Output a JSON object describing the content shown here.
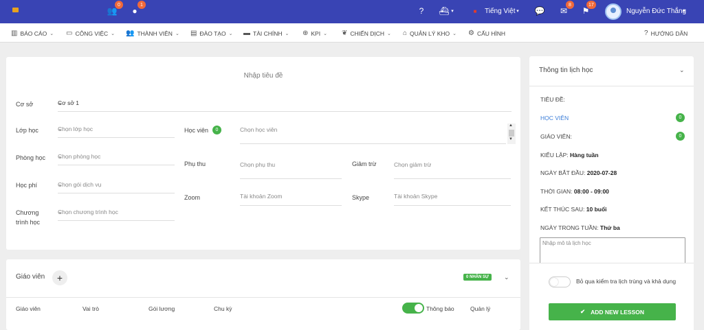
{
  "topbar": {
    "team_badge": "0",
    "chat_badge": "1",
    "language": "Tiếng Việt",
    "mail_badge": "8",
    "flag_badge": "17",
    "user_name": "Nguyễn Đức Thắng"
  },
  "menu": {
    "items": [
      {
        "label": "BÁO CÁO"
      },
      {
        "label": "CÔNG VIỆC"
      },
      {
        "label": "THÀNH VIÊN"
      },
      {
        "label": "ĐÀO TẠO"
      },
      {
        "label": "TÀI CHÍNH"
      },
      {
        "label": "KPI"
      },
      {
        "label": "CHIẾN DỊCH"
      },
      {
        "label": "QUẢN LÝ KHO"
      },
      {
        "label": "CẤU HÌNH"
      }
    ],
    "help": "HƯỚNG DẪN"
  },
  "form": {
    "title_placeholder": "Nhập tiêu đề",
    "co_so_label": "Cơ sở",
    "co_so_value": "Cơ sở 1",
    "lop_hoc_label": "Lớp học",
    "lop_hoc_placeholder": "Chọn lớp học",
    "hoc_vien_label": "Học viên",
    "hoc_vien_count": "0",
    "hoc_vien_placeholder": "Chọn học viên",
    "phong_hoc_label": "Phòng học",
    "phong_hoc_placeholder": "Chọn phòng học",
    "phu_thu_label": "Phụ thu",
    "phu_thu_placeholder": "Chọn phụ thu",
    "giam_tru_label": "Giảm trừ",
    "giam_tru_placeholder": "Chọn giảm trừ",
    "hoc_phi_label": "Học phí",
    "hoc_phi_placeholder": "Chọn gói dịch vụ",
    "zoom_label": "Zoom",
    "zoom_placeholder": "Tài khoản Zoom",
    "skype_label": "Skype",
    "skype_placeholder": "Tài khoản Skype",
    "chuong_trinh_label_1": "Chương",
    "chuong_trinh_label_2": "trình học",
    "chuong_trinh_placeholder": "Chọn chương trình học"
  },
  "teacher": {
    "title": "Giáo viên",
    "staff_badge": "0 NHÂN SỰ",
    "columns": [
      "Giáo viên",
      "Vai trò",
      "Gói lương",
      "Chu kỳ",
      "Thông báo",
      "Quản lý"
    ]
  },
  "side": {
    "title": "Thông tin lịch học",
    "tieu_de": "TIÊU ĐỀ:",
    "hoc_vien": "HỌC VIÊN",
    "hoc_vien_count": "0",
    "giao_vien": "GIÁO VIÊN:",
    "giao_vien_count": "0",
    "kieu_lap_label": "KIỂU LẶP:",
    "kieu_lap_value": "Hàng tuần",
    "ngay_bat_dau_label": "NGÀY BẮT ĐẦU:",
    "ngay_bat_dau_value": "2020-07-28",
    "thoi_gian_label": "THỜI GIAN:",
    "thoi_gian_value": "08:00 - 09:00",
    "ket_thuc_label": "KẾT THÚC SAU:",
    "ket_thuc_value": "10 buổi",
    "ngay_trong_tuan_label": "NGÀY TRONG TUẦN:",
    "ngay_trong_tuan_value": "Thứ ba",
    "desc_placeholder": "Nhập mô tả lịch học",
    "skip_text": "Bỏ qua kiểm tra lịch trùng và khả dụng",
    "add_button": "ADD NEW LESSON"
  },
  "colors": {
    "topbar": "#3944b4",
    "accent_green": "#46b34a",
    "badge_orange": "#f0693a",
    "link_blue": "#3b7dd8"
  }
}
